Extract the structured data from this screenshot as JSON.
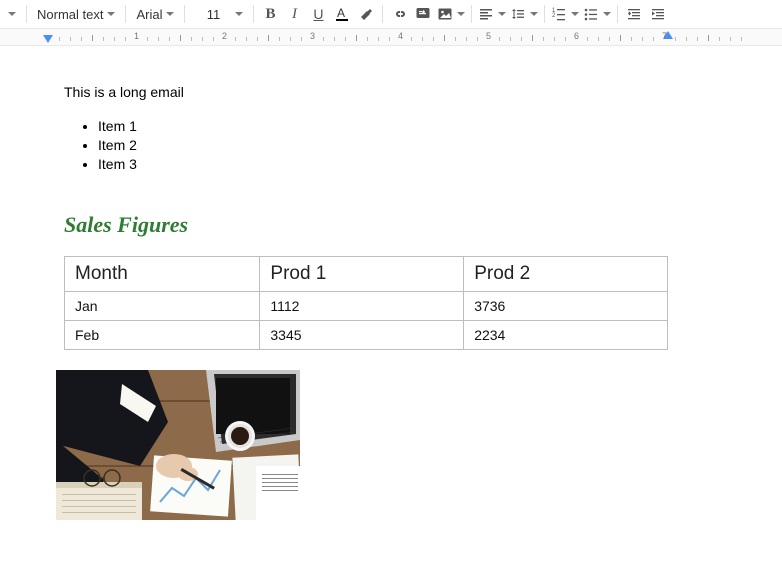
{
  "toolbar": {
    "styles_label": "Normal text",
    "font_label": "Arial",
    "font_size": "11"
  },
  "ruler": {
    "numbers": [
      "1",
      "2",
      "3",
      "4",
      "5",
      "6",
      "7"
    ]
  },
  "doc": {
    "intro": "This is a long email",
    "items": [
      "Item 1",
      "Item 2",
      "Item 3"
    ],
    "heading": "Sales Figures",
    "table": {
      "headers": [
        "Month",
        "Prod 1",
        "Prod 2"
      ],
      "rows": [
        [
          "Jan",
          "1112",
          "3736"
        ],
        [
          "Feb",
          "3345",
          "2234"
        ]
      ]
    }
  },
  "chart_data": {
    "type": "table",
    "title": "Sales Figures",
    "columns": [
      "Month",
      "Prod 1",
      "Prod 2"
    ],
    "rows": [
      {
        "Month": "Jan",
        "Prod 1": 1112,
        "Prod 2": 3736
      },
      {
        "Month": "Feb",
        "Prod 1": 3345,
        "Prod 2": 2234
      }
    ]
  }
}
